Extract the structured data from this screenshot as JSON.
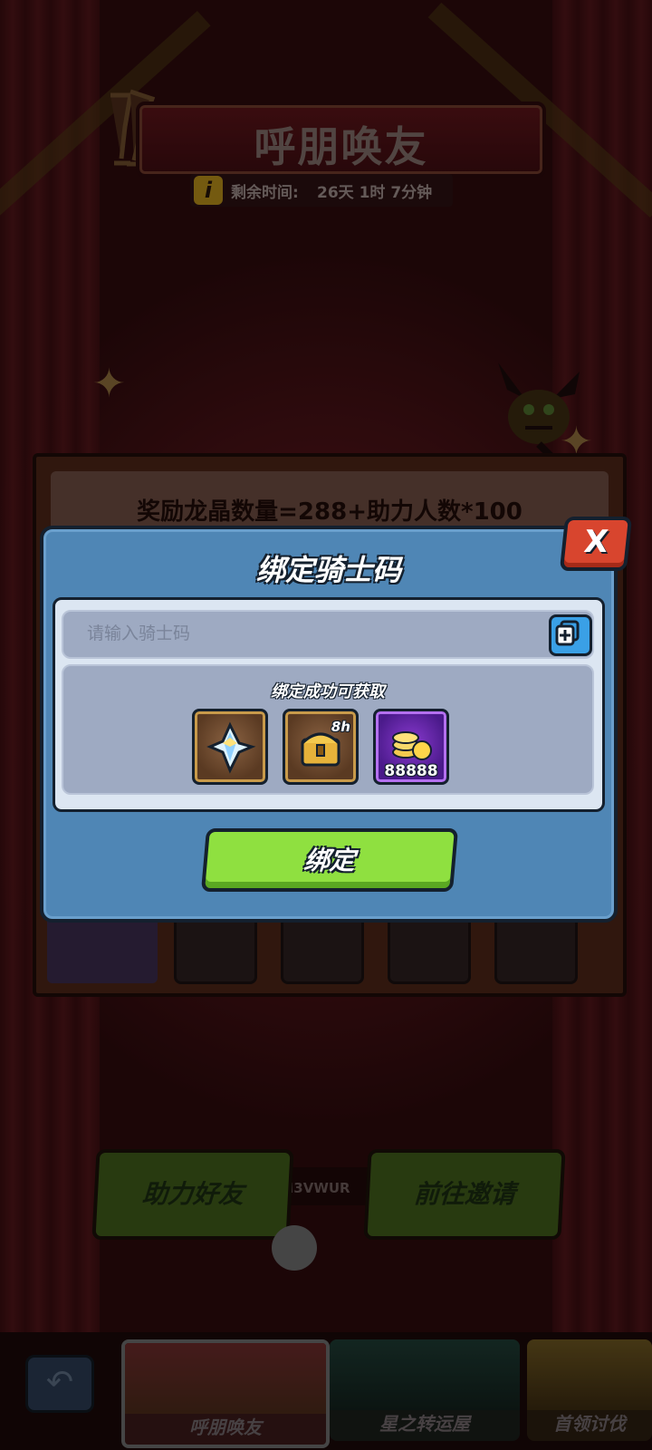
{
  "header": {
    "title": "呼朋唤友",
    "info_icon": "info-icon",
    "remaining_label": "剩余时间:",
    "remaining_value": "26天 1时 7分钟"
  },
  "board": {
    "formula_text": "奖励龙晶数量=288+助力人数*100"
  },
  "knight_code": {
    "label": "我的骑士码: L3KXGH3VWUR",
    "copy_icon": "copy-icon"
  },
  "actions": {
    "help_friend": "助力好友",
    "go_invite": "前往邀请"
  },
  "bottom_tabs": [
    {
      "label": "呼朋唤友",
      "selected": true
    },
    {
      "label": "星之转运屋",
      "selected": false
    },
    {
      "label": "首领讨伐",
      "selected": false
    }
  ],
  "dialog": {
    "title": "绑定骑士码",
    "close_label": "X",
    "input_placeholder": "请输入骑士码",
    "input_value": "",
    "paste_icon": "paste-icon",
    "rewards_title": "绑定成功可获取",
    "rewards": [
      {
        "icon": "crystal-icon",
        "tag": "",
        "count": ""
      },
      {
        "icon": "treasure-chest-icon",
        "tag": "8h",
        "count": ""
      },
      {
        "icon": "gold-coins-icon",
        "tag": "",
        "count": "88888"
      }
    ],
    "bind_label": "绑定"
  },
  "colors": {
    "dialog_blue": "#4f86b5",
    "bind_green": "#8fe040",
    "close_red": "#d8452e"
  }
}
